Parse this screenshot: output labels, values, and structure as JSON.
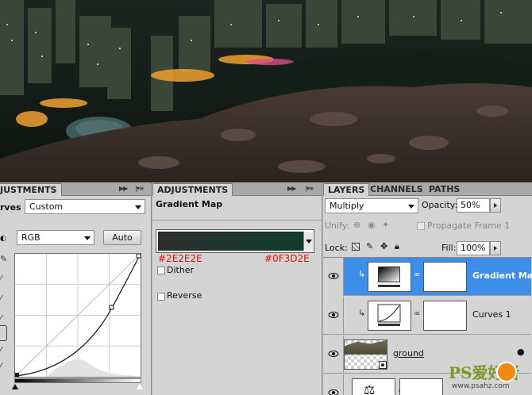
{
  "adjustments_left": {
    "tab_label": "JUSTMENTS",
    "title_partial": "rves",
    "preset_value": "Custom",
    "channel_value": "RGB",
    "auto_label": "Auto"
  },
  "adjustments_center": {
    "tab_label": "ADJUSTMENTS",
    "title": "Gradient Map",
    "color_left": "#2E2E2E",
    "color_right": "#0F3D2E",
    "dither_label": "Dither",
    "reverse_label": "Reverse"
  },
  "layers": {
    "tabs": [
      "LAYERS",
      "CHANNELS",
      "PATHS"
    ],
    "blend_mode": "Multiply",
    "opacity_label": "Opacity:",
    "opacity_value": "50%",
    "unify_label": "Unify:",
    "propagate_label": "Propagate Frame 1",
    "lock_label": "Lock:",
    "fill_label": "Fill:",
    "fill_value": "100%",
    "items": [
      {
        "name": "Gradient Map",
        "selected": true
      },
      {
        "name": "Curves 1",
        "selected": false
      },
      {
        "name": "ground",
        "selected": false
      },
      {
        "name": "",
        "selected": false
      }
    ]
  },
  "watermark": {
    "text": "PS爱好者",
    "url": "www.psahz.com"
  },
  "colors": {
    "panel_bg": "#d4d4d4",
    "selected_row": "#3d8ee8",
    "hex_text": "#e01010"
  }
}
